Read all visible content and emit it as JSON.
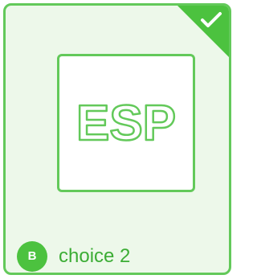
{
  "option": {
    "selected": true,
    "image_text": "ESP",
    "badge_letter": "B",
    "label": "choice 2",
    "check_icon": "check-icon"
  },
  "colors": {
    "accent": "#4cc23f",
    "border": "#63c95a",
    "card_background": "#edf8ea",
    "label_text": "#3cad35"
  }
}
